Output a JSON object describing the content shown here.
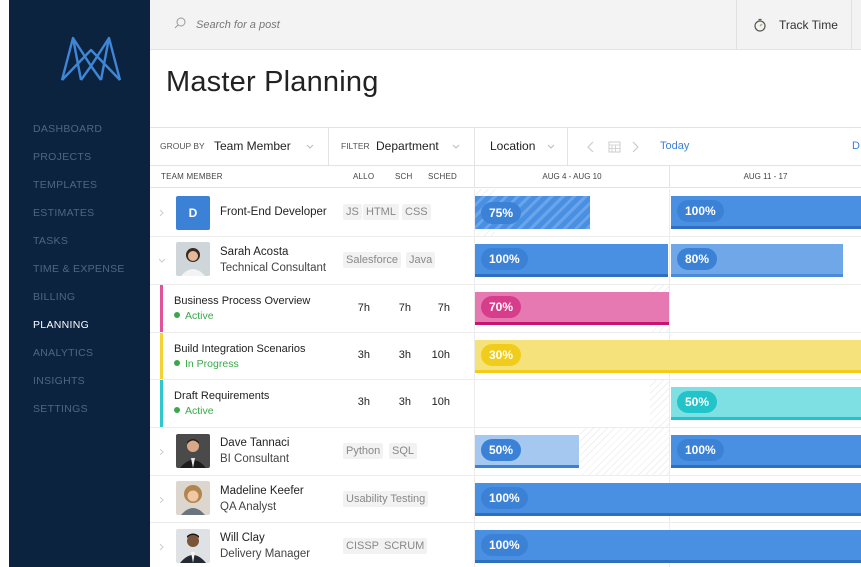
{
  "sidebar": {
    "items": [
      {
        "label": "DASHBOARD"
      },
      {
        "label": "PROJECTS"
      },
      {
        "label": "TEMPLATES"
      },
      {
        "label": "ESTIMATES"
      },
      {
        "label": "TASKS"
      },
      {
        "label": "TIME & EXPENSE"
      },
      {
        "label": "BILLING"
      },
      {
        "label": "PLANNING"
      },
      {
        "label": "ANALYTICS"
      },
      {
        "label": "INSIGHTS"
      },
      {
        "label": "SETTINGS"
      }
    ],
    "active": "PLANNING"
  },
  "topbar": {
    "search_placeholder": "Search for a post",
    "track_time_label": "Track Time"
  },
  "page": {
    "title": "Master Planning"
  },
  "toolbar": {
    "group_by_label": "GROUP BY",
    "group_by_value": "Team Member",
    "filter_label": "FILTER",
    "filter_value": "Department",
    "location_value": "Location",
    "today_label": "Today",
    "trailing_label": "D"
  },
  "columns": {
    "team_member": "TEAM MEMBER",
    "allo": "ALLO",
    "sch": "SCH",
    "sched": "SCHED",
    "week1": "AUG 4 - AUG 10",
    "week2": "AUG 11 - 17"
  },
  "rows": [
    {
      "type": "person",
      "initial": "D",
      "name": "Front-End Developer",
      "skills": [
        "JS",
        "HTML",
        "CSS"
      ],
      "week1": "75%",
      "week2": "100%"
    },
    {
      "type": "person",
      "name": "Sarah Acosta",
      "role": "Technical Consultant",
      "skills": [
        "Salesforce",
        "Java"
      ],
      "week1": "100%",
      "week2": "80%"
    },
    {
      "type": "task",
      "name": "Business Process Overview",
      "status": "Active",
      "allo": "7h",
      "sch": "7h",
      "sched": "7h",
      "week1": "70%"
    },
    {
      "type": "task",
      "name": "Build Integration Scenarios",
      "status": "In Progress",
      "allo": "3h",
      "sch": "3h",
      "sched": "10h",
      "week1": "30%"
    },
    {
      "type": "task",
      "name": "Draft Requirements",
      "status": "Active",
      "allo": "3h",
      "sch": "3h",
      "sched": "10h",
      "week2": "50%"
    },
    {
      "type": "person",
      "name": "Dave Tannaci",
      "role": "BI Consultant",
      "skills": [
        "Python",
        "SQL"
      ],
      "week1": "50%",
      "week2": "100%"
    },
    {
      "type": "person",
      "name": "Madeline Keefer",
      "role": "QA Analyst",
      "skills": [
        "Usability Testing"
      ],
      "week1": "100%"
    },
    {
      "type": "person",
      "name": "Will Clay",
      "role": "Delivery Manager",
      "skills": [
        "CISSP",
        "SCRUM"
      ],
      "week1": "100%"
    }
  ],
  "colors": {
    "sidebar_bg": "#0c2340",
    "accent_blue": "#3b82d6",
    "bar_blue": "#4a90e2",
    "light_blue": "#a4c8f0",
    "pink": "#e0539b",
    "yellow": "#f6e27a",
    "cyan": "#7fe0e3",
    "status_green": "#3aa84a"
  }
}
